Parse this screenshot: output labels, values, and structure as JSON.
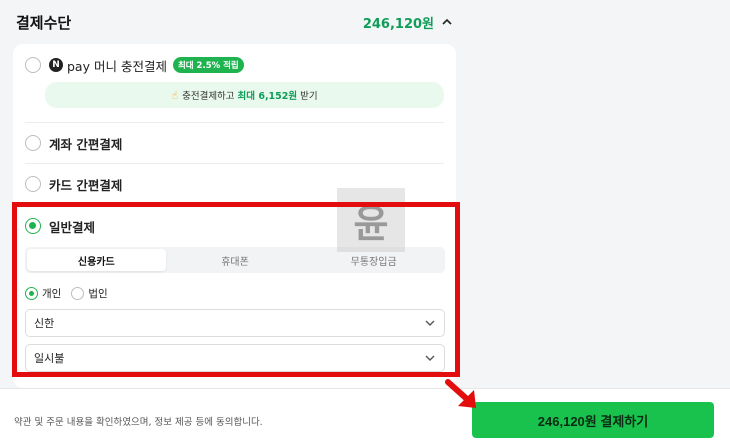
{
  "header": {
    "title": "결제수단",
    "amount": "246,120원"
  },
  "methods": {
    "npay": {
      "badge": "N",
      "label": "pay 머니 충전결제",
      "tag": "최대 2.5% 적립"
    },
    "promo": {
      "prefix": "충전결제하고",
      "highlight": "최대 6,152원",
      "suffix": "받기"
    },
    "account": {
      "label": "계좌 간편결제"
    },
    "card": {
      "label": "카드 간편결제"
    },
    "general": {
      "label": "일반결제"
    }
  },
  "tabs": [
    {
      "label": "신용카드",
      "active": true
    },
    {
      "label": "휴대폰",
      "active": false
    },
    {
      "label": "무통장입금",
      "active": false
    }
  ],
  "card_owner": {
    "personal": "개인",
    "corporate": "법인",
    "selected": "개인"
  },
  "selects": {
    "card_company": "신한",
    "installment": "일시불"
  },
  "watermark_text": "윤",
  "footer": {
    "agreement": "약관 및 주문 내용을 확인하였으며, 정보 제공 등에 동의합니다.",
    "pay_button": "246,120원 결제하기"
  },
  "colors": {
    "accent": "#1fb350",
    "button": "#19c24d",
    "highlight_box": "#e30d0d"
  }
}
